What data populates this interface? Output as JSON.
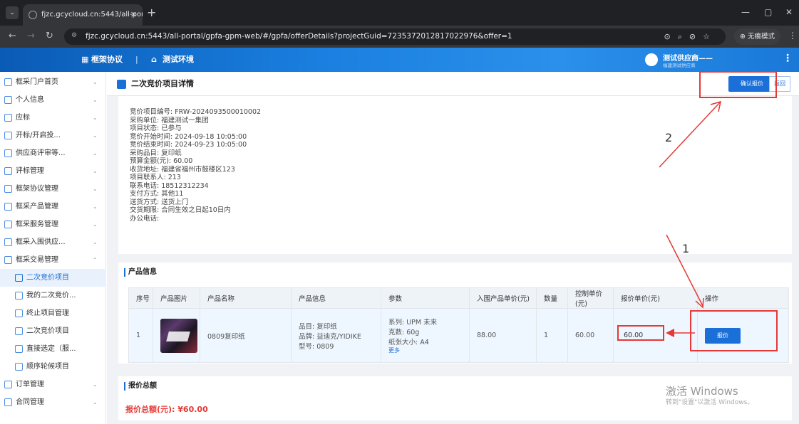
{
  "browser": {
    "tab_title": "fjzc.gcycloud.cn:5443/all-por",
    "tab_close": "✕",
    "new_tab": "+",
    "url": "fjzc.gcycloud.cn:5443/all-portal/gpfa-gpm-web/#/gpfa/offerDetails?projectGuid=7235372012817022976&offer=1",
    "incognito_label": "无痕模式",
    "win_min": "—",
    "win_restore": "▢",
    "win_close": "✕"
  },
  "header": {
    "nav1": "框架协议",
    "separator": "|",
    "nav2": "测试环境",
    "user_name": "测试供应商——",
    "user_sub": "福建测试供应商"
  },
  "sidebar": {
    "items": [
      {
        "label": "框采门户首页",
        "chev": "⌄"
      },
      {
        "label": "个人信息",
        "chev": "⌄"
      },
      {
        "label": "应标",
        "chev": "⌄"
      },
      {
        "label": "开标/开启投...",
        "chev": "⌄"
      },
      {
        "label": "供应商评审等...",
        "chev": "⌄"
      },
      {
        "label": "评标管理",
        "chev": "⌄"
      },
      {
        "label": "框架协议管理",
        "chev": "⌄"
      },
      {
        "label": "框采产品管理",
        "chev": "⌄"
      },
      {
        "label": "框采服务管理",
        "chev": "⌄"
      },
      {
        "label": "框采入围供应...",
        "chev": "⌄"
      },
      {
        "label": "框采交易管理",
        "chev": "⌃"
      }
    ],
    "subitems": [
      {
        "label": "二次竞价项目"
      },
      {
        "label": "我的二次竞价..."
      },
      {
        "label": "终止项目管理"
      },
      {
        "label": "二次竞价项目"
      },
      {
        "label": "直接选定（服..."
      },
      {
        "label": "顺序轮候项目"
      }
    ],
    "bottom_items": [
      {
        "label": "订单管理",
        "chev": "⌄"
      },
      {
        "label": "合同管理",
        "chev": "⌄"
      }
    ]
  },
  "page": {
    "title": "二次竞价项目详情",
    "confirm_button": "确认报价",
    "back_button": "返回"
  },
  "info": [
    "竞价项目编号: FRW-2024093500010002",
    "采购单位: 福建测试一集团",
    "项目状态: 已参与",
    "竞价开始时间: 2024-09-18 10:05:00",
    "竞价结束时间: 2024-09-23 10:05:00",
    "采购品目: 复印纸",
    "预算金额(元): 60.00",
    "收货地址: 福建省福州市鼓楼区123",
    "项目联系人: 213",
    "联系电话: 18512312234",
    "支付方式: 其他11",
    "送货方式: 送货上门",
    "交货期限: 合同生效之日起10日内",
    "办公电话:"
  ],
  "product": {
    "section_title": "产品信息",
    "headers": [
      "序号",
      "产品图片",
      "产品名称",
      "产品信息",
      "参数",
      "入围产品单价(元)",
      "数量",
      "控制单价(元)",
      "报价单价(元)",
      "操作"
    ],
    "row": {
      "index": "1",
      "name": "0809复印纸",
      "info": [
        "品目: 复印纸",
        "品牌: 益迪克/YIDIKE",
        "型号: 0809"
      ],
      "params": [
        "系列: UPM 未来",
        "克数: 60g",
        "纸张大小: A4"
      ],
      "params_more": "更多",
      "entry_price": "88.00",
      "quantity": "1",
      "control_price": "60.00",
      "quote_price": "60.00",
      "action": "报价"
    }
  },
  "total": {
    "section_title": "报价总额",
    "value": "报价总额(元): ¥60.00"
  },
  "watermark": {
    "line1": "激活 Windows",
    "line2": "转到\"设置\"以激活 Windows。"
  },
  "annotations": {
    "n1": "1",
    "n2": "2"
  },
  "colors": {
    "primary": "#1a6fd8",
    "annotation_red": "#e53935",
    "total_red": "#e53935"
  }
}
